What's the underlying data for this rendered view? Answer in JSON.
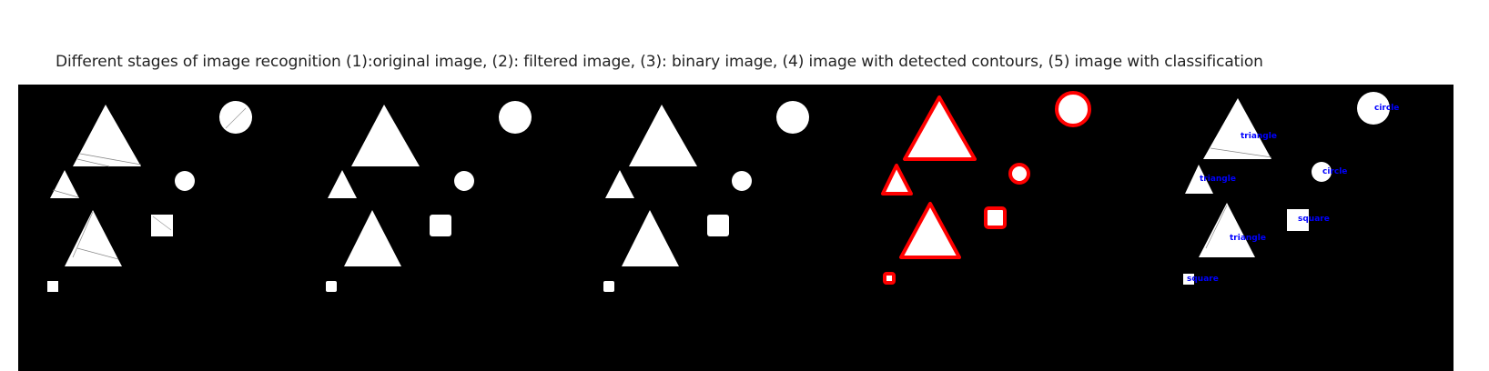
{
  "caption": "Different stages of image recognition (1):original image, (2): filtered image, (3): binary image, (4) image with detected contours, (5) image with classification",
  "colors": {
    "background": "#000000",
    "shape": "#ffffff",
    "contour": "#ff0000",
    "label": "#0000ff"
  },
  "panels": [
    {
      "id": "original",
      "stage": 1
    },
    {
      "id": "filtered",
      "stage": 2
    },
    {
      "id": "binary",
      "stage": 3
    },
    {
      "id": "contours",
      "stage": 4
    },
    {
      "id": "classification",
      "stage": 5
    }
  ],
  "classification_labels": {
    "big_triangle": "triangle",
    "small_triangle": "triangle",
    "mid_triangle": "triangle",
    "big_circle": "circle",
    "small_circle": "circle",
    "square": "square",
    "tiny_square": "square"
  }
}
